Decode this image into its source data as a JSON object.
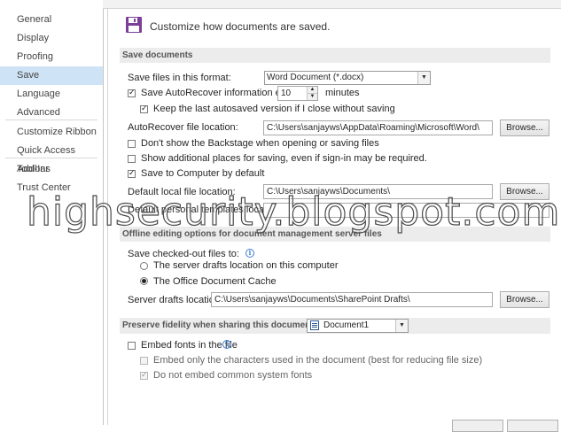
{
  "sidebar": {
    "items": [
      {
        "label": "General",
        "selected": false
      },
      {
        "label": "Display",
        "selected": false
      },
      {
        "label": "Proofing",
        "selected": false
      },
      {
        "label": "Save",
        "selected": true
      },
      {
        "label": "Language",
        "selected": false
      },
      {
        "label": "Advanced",
        "selected": false
      },
      {
        "label": "Customize Ribbon",
        "selected": false
      },
      {
        "label": "Quick Access Toolbar",
        "selected": false
      },
      {
        "label": "Add-Ins",
        "selected": false
      },
      {
        "label": "Trust Center",
        "selected": false
      }
    ]
  },
  "header": {
    "icon": "save-disk-icon",
    "title": "Customize how documents are saved."
  },
  "save_documents": {
    "section_title": "Save documents",
    "format_label": "Save files in this format:",
    "format_value": "Word Document (*.docx)",
    "autorecover_label": "Save AutoRecover information every",
    "autorecover_checked": true,
    "autorecover_minutes": "10",
    "minutes_label": "minutes",
    "keep_last_label": "Keep the last autosaved version if I close without saving",
    "keep_last_checked": true,
    "autorecover_location_label": "AutoRecover file location:",
    "autorecover_location_value": "C:\\Users\\sanjayws\\AppData\\Roaming\\Microsoft\\Word\\",
    "browse_label": "Browse...",
    "no_backstage_label": "Don't show the Backstage when opening or saving files",
    "no_backstage_checked": false,
    "show_additional_label": "Show additional places for saving, even if sign-in may be required.",
    "show_additional_checked": false,
    "save_computer_label": "Save to Computer by default",
    "save_computer_checked": true,
    "default_local_label": "Default local file location:",
    "default_local_value": "C:\\Users\\sanjayws\\Documents\\",
    "personal_templates_label": "Default personal templates location:",
    "personal_templates_value": ""
  },
  "offline": {
    "section_title": "Offline editing options for document management server files",
    "checked_out_label": "Save checked-out files to:",
    "server_drafts_radio": "The server drafts location on this computer",
    "server_drafts_checked": false,
    "office_cache_radio": "The Office Document Cache",
    "office_cache_checked": true,
    "server_drafts_location_label": "Server drafts location:",
    "server_drafts_location_value": "C:\\Users\\sanjayws\\Documents\\SharePoint Drafts\\"
  },
  "fidelity": {
    "section_title": "Preserve fidelity when sharing this document:",
    "document_value": "Document1",
    "embed_fonts_label": "Embed fonts in the file",
    "embed_fonts_checked": false,
    "embed_chars_label": "Embed only the characters used in the document (best for reducing file size)",
    "embed_chars_checked": false,
    "no_common_label": "Do not embed common system fonts",
    "no_common_checked": true
  },
  "watermark": "highsecurity.blogspot.com",
  "colors": {
    "selected_nav": "#cfe3f6",
    "save_icon": "#7b3f98",
    "info_icon": "#3a7fd0"
  }
}
